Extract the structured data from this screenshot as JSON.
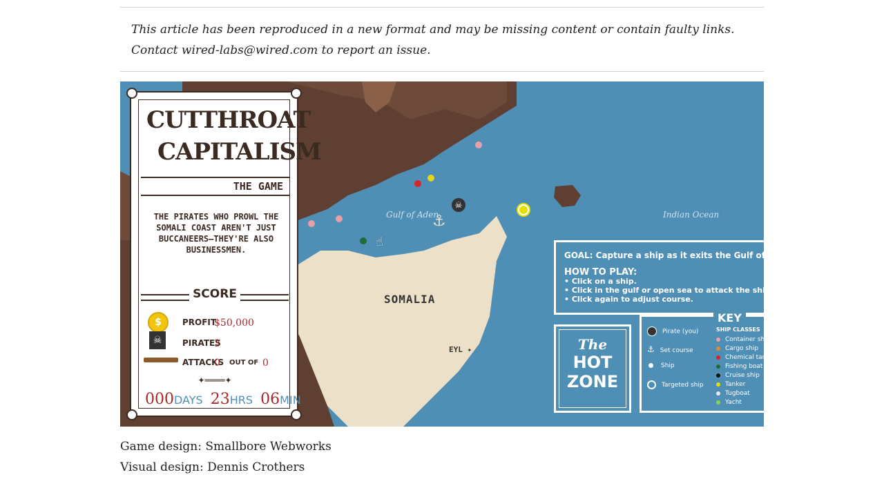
{
  "notice": "This article has been reproduced in a new format and may be missing content or contain faulty links. Contact wired-labs@wired.com to report an issue.",
  "game": {
    "logo_line1": "CUTTHROAT",
    "logo_line2": "CAPITALISM",
    "subtitle": "THE GAME",
    "tagline": "THE PIRATES WHO PROWL THE SOMALI COAST AREN'T JUST BUCCANEERS—THEY'RE ALSO BUSINESSMEN.",
    "score": {
      "heading": "SCORE",
      "profit_label": "PROFIT",
      "profit_value": "$50,000",
      "pirates_label": "PIRATES",
      "pirates_value": "3",
      "attacks_label": "ATTACKS",
      "attacks_value": "0",
      "out_of_label": "OUT OF",
      "attacks_total": "0",
      "ornament": "✦════✦"
    },
    "timer": {
      "days": "000",
      "days_unit": "DAYS",
      "hours": "23",
      "hours_unit": "HRS",
      "minutes": "06",
      "minutes_unit": "MIN"
    },
    "map": {
      "gulf_label": "Gulf of Aden",
      "ocean_label": "Indian Ocean",
      "country_label": "SOMALIA",
      "city_label": "EYL ✦"
    },
    "ships": [
      {
        "color": "#e8a0a8"
      },
      {
        "color": "#e8a0a8"
      },
      {
        "color": "#e8a0a8"
      },
      {
        "color": "#d7262b"
      },
      {
        "color": "#e6d51b"
      },
      {
        "color": "#1f6b3a"
      },
      {
        "color": "#e6e000",
        "targeted": true
      }
    ],
    "instructions": {
      "goal": "GOAL: Capture a ship as it exits the Gulf of Aden.",
      "how_to": "HOW TO PLAY:",
      "steps": [
        "• Click on a ship.",
        "• Click in the gulf or open sea to attack the ship.",
        "• Click again to adjust course."
      ]
    },
    "hot_zone": {
      "line1": "The",
      "line2": "HOT",
      "line3": "ZONE"
    },
    "key": {
      "title": "KEY",
      "rows": [
        {
          "label": "Pirate (you)",
          "icon": "skull-icon"
        },
        {
          "label": "Set course",
          "icon": "anchor-icon"
        },
        {
          "label": "Ship",
          "icon": "ship-dot-icon"
        },
        {
          "label": "Targeted ship",
          "icon": "target-icon"
        }
      ],
      "classes_title": "SHIP CLASSES",
      "classes": [
        {
          "label": "Container ship",
          "color": "#e8a0a8"
        },
        {
          "label": "Cargo ship",
          "color": "#e08a2a"
        },
        {
          "label": "Chemical tanker",
          "color": "#d7262b"
        },
        {
          "label": "Fishing boat",
          "color": "#1f6b3a"
        },
        {
          "label": "Cruise ship",
          "color": "#111111"
        },
        {
          "label": "Tanker",
          "color": "#e6e000"
        },
        {
          "label": "Tugboat",
          "color": "#e8e8e8"
        },
        {
          "label": "Yacht",
          "color": "#8fd14f"
        }
      ]
    }
  },
  "credits": {
    "game_design": "Game design: Smallbore Webworks",
    "visual_design": "Visual design: Dennis Crothers"
  }
}
